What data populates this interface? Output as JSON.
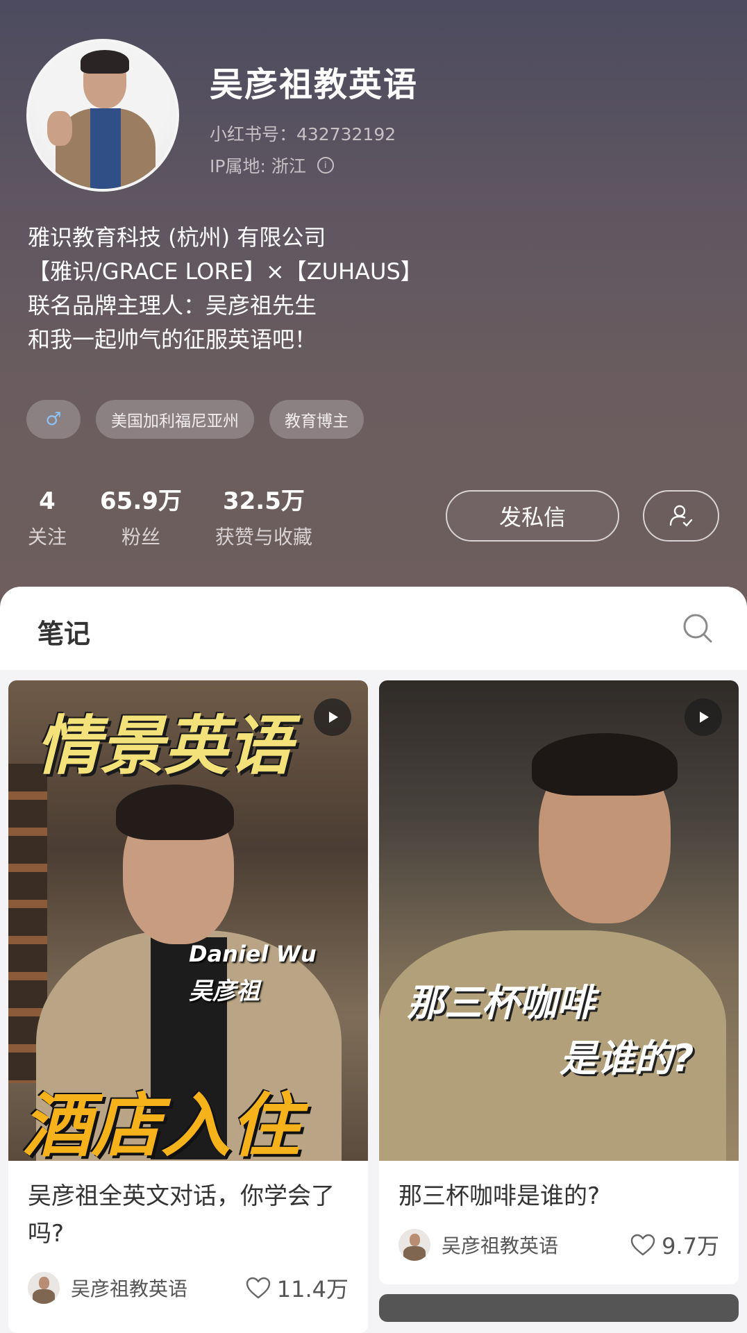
{
  "profile": {
    "name": "吴彦祖教英语",
    "xhs_id": "小红书号：432732192",
    "ip": "IP属地: 浙江",
    "bio": [
      "雅识教育科技 (杭州) 有限公司",
      "【雅识/GRACE LORE】×【ZUHAUS】",
      "联名品牌主理人：吴彦祖先生",
      "和我一起帅气的征服英语吧！"
    ],
    "tags": {
      "gender": "♂",
      "location": "美国加利福尼亚州",
      "category": "教育博主"
    },
    "stats": {
      "following": {
        "num": "4",
        "label": "关注"
      },
      "followers": {
        "num": "65.9万",
        "label": "粉丝"
      },
      "likes": {
        "num": "32.5万",
        "label": "获赞与收藏"
      }
    },
    "message_button": "发私信"
  },
  "notes_section": {
    "tab_label": "笔记"
  },
  "notes": [
    {
      "cover_top": "情景英语",
      "cover_name_en": "Daniel Wu",
      "cover_name_cn": "吴彦祖",
      "cover_bottom": "酒店入住",
      "title": "吴彦祖全英文对话，你学会了吗?",
      "author": "吴彦祖教英语",
      "likes": "11.4万"
    },
    {
      "cover_line1": "那三杯咖啡",
      "cover_line2": "是谁的?",
      "title": "那三杯咖啡是谁的?",
      "author": "吴彦祖教英语",
      "likes": "9.7万"
    }
  ],
  "colors": {
    "accent_gender": "#8fc1f2",
    "cover_yellow": "#f3e27a",
    "cover_orange": "#f6b21a"
  }
}
